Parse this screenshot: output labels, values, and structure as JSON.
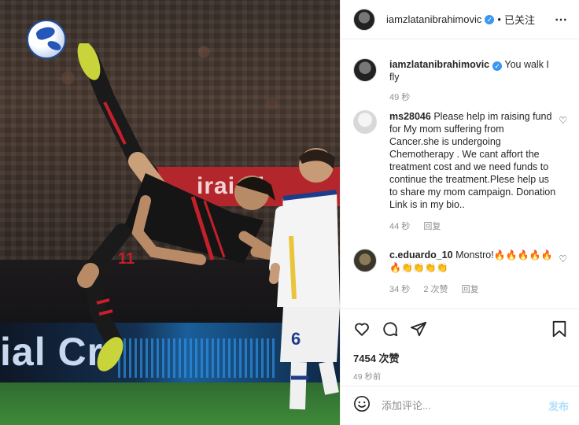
{
  "post": {
    "username": "iamzlatanibrahimovic",
    "follow_status": "已关注",
    "caption": "You walk I fly",
    "caption_time": "49 秒",
    "likes": "7454 次赞",
    "posted_ago": "49 秒前"
  },
  "photo": {
    "banner_text": "irai Fl",
    "board_text": "ial Cr"
  },
  "comments": [
    {
      "username": "ms28046",
      "text": "Please help im raising fund for My mom suffering from Cancer.she is undergoing Chemotherapy . We cant affort the treatment cost and we need funds to continue the treatment.Plese help us to share my mom campaign. Donation Link is in my bio..",
      "time": "44 秒",
      "reply": "回复"
    },
    {
      "username": "c.eduardo_10",
      "text": "Monstro!",
      "emojis_line1": "🔥🔥🔥🔥🔥",
      "emojis_line2": "🔥👏👏👏👏",
      "time": "34 秒",
      "likes": "2 次赞",
      "reply": "回复"
    }
  ],
  "add_comment": {
    "placeholder": "添加评论...",
    "post_label": "发布"
  },
  "icons": {
    "more": "more-options-icon",
    "like": "heart-icon",
    "comment": "comment-icon",
    "share": "paper-plane-icon",
    "save": "bookmark-icon",
    "emoji": "smiley-icon"
  },
  "colors": {
    "verified": "#3897f0",
    "muted_text": "#8e8e8e",
    "post_button_disabled": "#b2dffc"
  }
}
